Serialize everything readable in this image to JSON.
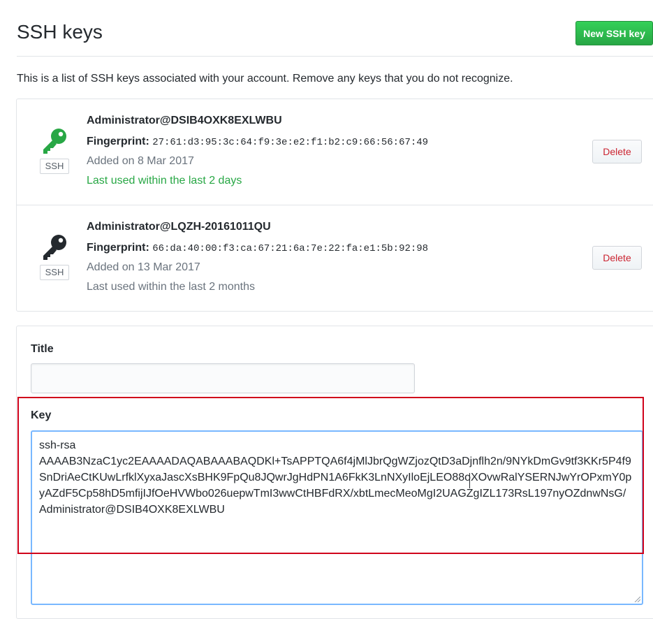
{
  "header": {
    "title": "SSH keys",
    "new_key_button": "New SSH key"
  },
  "intro_text": "This is a list of SSH keys associated with your account. Remove any keys that you do not recognize.",
  "keys": [
    {
      "name": "Administrator@DSIB4OXK8EXLWBU",
      "fingerprint_label": "Fingerprint:",
      "fingerprint": "27:61:d3:95:3c:64:f9:3e:e2:f1:b2:c9:66:56:67:49",
      "added": "Added on 8 Mar 2017",
      "last_used": "Last used within the last 2 days",
      "badge": "SSH",
      "delete_label": "Delete",
      "icon": "key-icon",
      "icon_color": "#28a745"
    },
    {
      "name": "Administrator@LQZH-20161011QU",
      "fingerprint_label": "Fingerprint:",
      "fingerprint": "66:da:40:00:f3:ca:67:21:6a:7e:22:fa:e1:5b:92:98",
      "added": "Added on 13 Mar 2017",
      "last_used": "Last used within the last 2 months",
      "badge": "SSH",
      "delete_label": "Delete",
      "icon": "key-icon",
      "icon_color": "#24292e"
    }
  ],
  "form": {
    "title_label": "Title",
    "title_value": "",
    "key_label": "Key",
    "key_value": "ssh-rsa\nAAAAB3NzaC1yc2EAAAADAQABAAABAQDKl+TsAPPTQA6f4jMlJbrQgWZjozQtD3aDjnflh2n/9NYkDmGv9tf3KKr5P4f9SnDriAeCtKUwLrfklXyxaJascXsBHK9FpQu8JQwrJgHdPN1A6FkK3LnNXyIloEjLEO88oXOvwRalYSERNJwYrOPxmY0pyAZdF5Cp58hD5mfijIJfOeHVWbo026uepwTmI3wwCtHBFdRX/xbtLmecMeoMgI2UAGZgIZL173RsL197nyOZdnwNsG/ Administrator@DSIB4OXK8EXLWBU"
  },
  "colors": {
    "primary_button": "#28a745",
    "danger_text": "#cb2431",
    "highlight_border": "#d0021b",
    "focus_border": "#79b8ff"
  }
}
